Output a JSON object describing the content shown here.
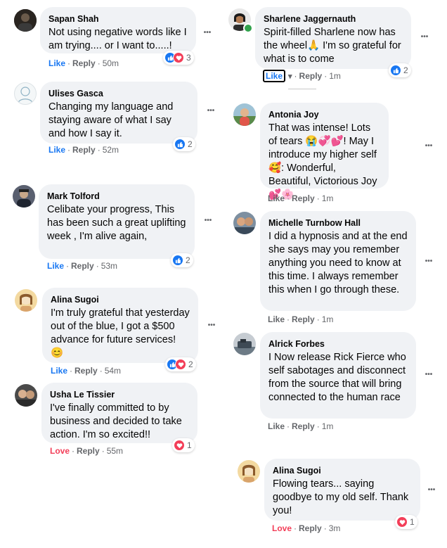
{
  "ui": {
    "like": "Like",
    "love": "Love",
    "reply": "Reply",
    "sep": "·",
    "more": "•••",
    "caret": "▾"
  },
  "comments": [
    {
      "name": "Sapan Shah",
      "text": "Not using negative words like I am trying.... or I want to.....!",
      "reaction_label": "Like",
      "time": "50m",
      "count": "3"
    },
    {
      "name": "Ulises Gasca",
      "text": "Changing my language and staying aware of what I say and how I say it.",
      "reaction_label": "Like",
      "time": "52m",
      "count": "2"
    },
    {
      "name": "Mark Tolford",
      "text": "Celibate your progress, This has been such a great uplifting week , I'm alive again,",
      "reaction_label": "Like",
      "time": "53m",
      "count": "2"
    },
    {
      "name": "Alina Sugoi",
      "text": "I'm truly grateful that yesterday out of the blue, I got a $500 advance for future services! 😊",
      "reaction_label": "Like",
      "time": "54m",
      "count": "2"
    },
    {
      "name": "Usha Le Tissier",
      "text": "I've finally committed to by business and decided to take action. I'm so excited!!",
      "reaction_label": "Love",
      "time": "55m",
      "count": "1"
    },
    {
      "name": "Sharlene Jaggernauth",
      "text": "Spirit-filled Sharlene now has the wheel🙏 I'm so grateful for what is to come",
      "reaction_label": "Like",
      "time": "1m",
      "count": "2"
    },
    {
      "name": "Antonia Joy",
      "text": "That was intense! Lots of tears 😭💞💕! May I introduce my higher self🥰: Wonderful, Beautiful, Victorious Joy💕🌸",
      "reaction_label": "Like",
      "time": "1m",
      "count": ""
    },
    {
      "name": "Michelle Turnbow Hall",
      "text": "I did a hypnosis and at the end she says may you remember anything you need to know at this time. I always remember this when I go through these.",
      "reaction_label": "Like",
      "time": "1m",
      "count": ""
    },
    {
      "name": "Alrick Forbes",
      "text": "I Now release Rick Fierce who self sabotages and disconnect from the source that will bring connected to the human race",
      "reaction_label": "Like",
      "time": "1m",
      "count": ""
    },
    {
      "name": "Alina Sugoi",
      "text": "Flowing tears... saying goodbye to my old self. Thank you!",
      "reaction_label": "Love",
      "time": "3m",
      "count": "1"
    }
  ]
}
